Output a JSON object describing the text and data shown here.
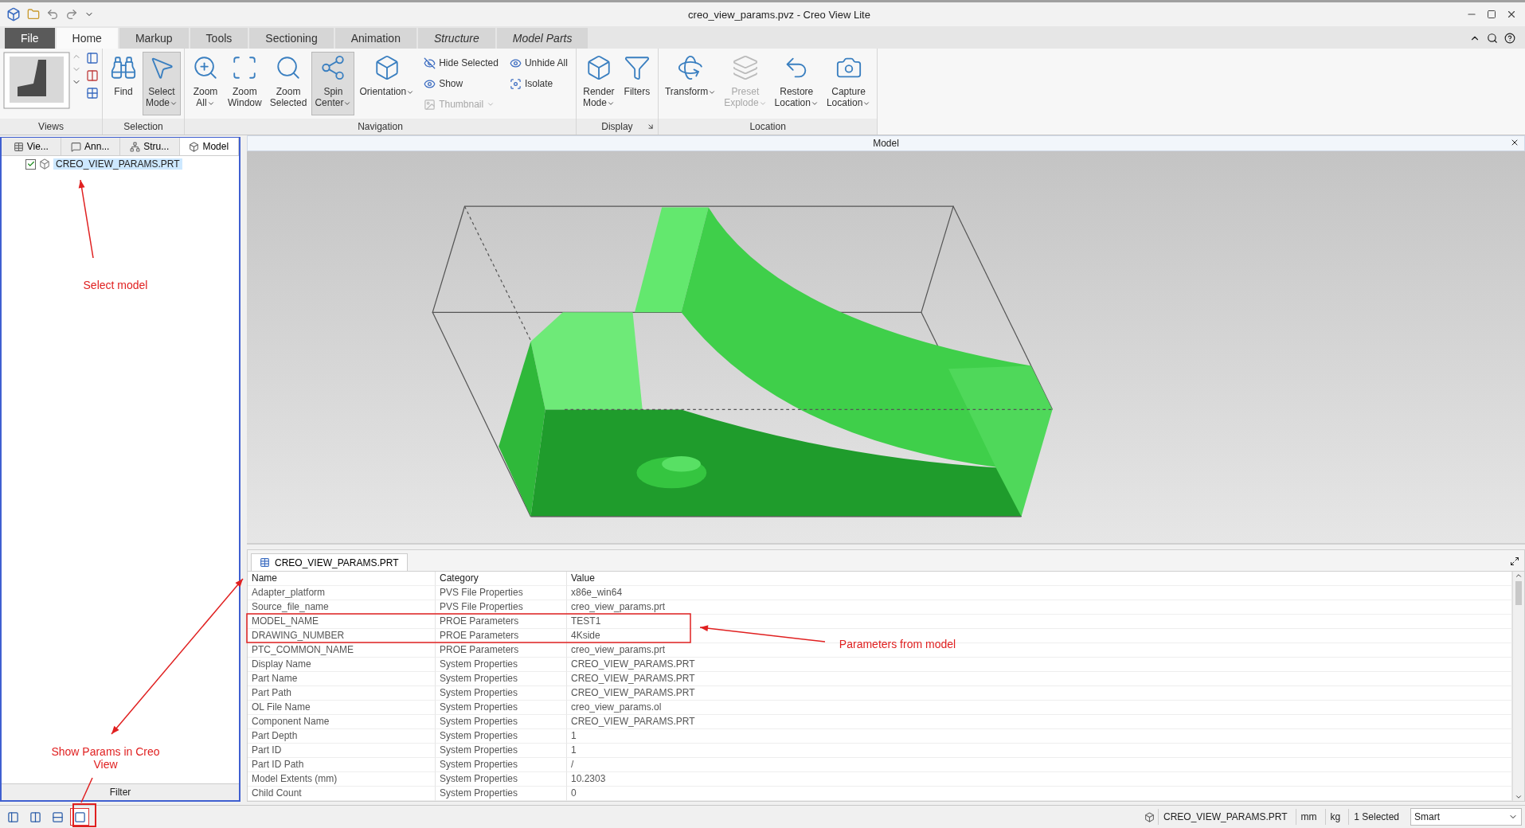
{
  "window": {
    "title": "creo_view_params.pvz - Creo View Lite"
  },
  "ribbon_tabs": [
    {
      "label": "File",
      "kind": "file",
      "selected": false
    },
    {
      "label": "Home",
      "kind": "normal",
      "selected": true
    },
    {
      "label": "Markup",
      "kind": "normal",
      "selected": false
    },
    {
      "label": "Tools",
      "kind": "normal",
      "selected": false
    },
    {
      "label": "Sectioning",
      "kind": "normal",
      "selected": false
    },
    {
      "label": "Animation",
      "kind": "normal",
      "selected": false
    },
    {
      "label": "Structure",
      "kind": "contextual",
      "selected": false
    },
    {
      "label": "Model Parts",
      "kind": "contextual",
      "selected": false
    }
  ],
  "ribbon_groups": [
    {
      "title": "Views",
      "kind": "views"
    },
    {
      "title": "Selection",
      "kind": "buttons",
      "buttons": [
        {
          "lines": [
            "Find"
          ],
          "pressed": false,
          "disabled": false,
          "dropdown": false
        },
        {
          "lines": [
            "Select",
            "Mode"
          ],
          "pressed": true,
          "disabled": false,
          "dropdown": true
        }
      ]
    },
    {
      "title": "Navigation",
      "kind": "buttons",
      "buttons": [
        {
          "lines": [
            "Zoom",
            "All"
          ],
          "pressed": false,
          "disabled": false,
          "dropdown": true
        },
        {
          "lines": [
            "Zoom",
            "Window"
          ],
          "pressed": false,
          "disabled": false,
          "dropdown": false
        },
        {
          "lines": [
            "Zoom",
            "Selected"
          ],
          "pressed": false,
          "disabled": false,
          "dropdown": false
        },
        {
          "lines": [
            "Spin",
            "Center"
          ],
          "pressed": true,
          "disabled": false,
          "dropdown": true
        },
        {
          "lines": [
            "Orientation"
          ],
          "pressed": false,
          "disabled": false,
          "dropdown": true
        }
      ],
      "small_buttons": [
        [
          {
            "label": "Hide Selected",
            "disabled": false,
            "dropdown": false
          },
          {
            "label": "Show",
            "disabled": false,
            "dropdown": false
          },
          {
            "label": "Thumbnail",
            "disabled": true,
            "dropdown": true
          }
        ],
        [
          {
            "label": "Unhide All",
            "disabled": false,
            "dropdown": false
          },
          {
            "label": "Isolate",
            "disabled": false,
            "dropdown": false
          }
        ]
      ]
    },
    {
      "title": "Display",
      "kind": "buttons",
      "launcher": true,
      "buttons": [
        {
          "lines": [
            "Render",
            "Mode"
          ],
          "pressed": false,
          "disabled": false,
          "dropdown": true
        },
        {
          "lines": [
            "Filters"
          ],
          "pressed": false,
          "disabled": false,
          "dropdown": false
        }
      ]
    },
    {
      "title": "Location",
      "kind": "buttons",
      "buttons": [
        {
          "lines": [
            "Transform"
          ],
          "pressed": false,
          "disabled": false,
          "dropdown": true
        },
        {
          "lines": [
            "Preset",
            "Explode"
          ],
          "pressed": false,
          "disabled": true,
          "dropdown": true
        },
        {
          "lines": [
            "Restore",
            "Location"
          ],
          "pressed": false,
          "disabled": false,
          "dropdown": true
        },
        {
          "lines": [
            "Capture",
            "Location"
          ],
          "pressed": false,
          "disabled": false,
          "dropdown": true
        }
      ]
    }
  ],
  "sidebar": {
    "tabs": [
      {
        "label": "Vie...",
        "selected": false
      },
      {
        "label": "Ann...",
        "selected": false
      },
      {
        "label": "Stru...",
        "selected": false
      },
      {
        "label": "Model",
        "selected": true
      }
    ],
    "tree": [
      {
        "label": "CREO_VIEW_PARAMS.PRT",
        "checked": true,
        "selected": true
      }
    ],
    "footer": "Filter"
  },
  "viewport": {
    "title": "Model"
  },
  "properties": {
    "tab": "CREO_VIEW_PARAMS.PRT",
    "columns": [
      "Name",
      "Category",
      "Value"
    ],
    "rows": [
      [
        "Adapter_platform",
        "PVS File Properties",
        "x86e_win64"
      ],
      [
        "Source_file_name",
        "PVS File Properties",
        "creo_view_params.prt"
      ],
      [
        "MODEL_NAME",
        "PROE Parameters",
        "TEST1"
      ],
      [
        "DRAWING_NUMBER",
        "PROE Parameters",
        "4Kside"
      ],
      [
        "PTC_COMMON_NAME",
        "PROE Parameters",
        "creo_view_params.prt"
      ],
      [
        "Display Name",
        "System Properties",
        "CREO_VIEW_PARAMS.PRT"
      ],
      [
        "Part Name",
        "System Properties",
        "CREO_VIEW_PARAMS.PRT"
      ],
      [
        "Part Path",
        "System Properties",
        "CREO_VIEW_PARAMS.PRT"
      ],
      [
        "OL File Name",
        "System Properties",
        "creo_view_params.ol"
      ],
      [
        "Component Name",
        "System Properties",
        "CREO_VIEW_PARAMS.PRT"
      ],
      [
        "Part Depth",
        "System Properties",
        "1"
      ],
      [
        "Part ID",
        "System Properties",
        "1"
      ],
      [
        "Part ID Path",
        "System Properties",
        "/"
      ],
      [
        "Model Extents (mm)",
        "System Properties",
        "10.2303"
      ],
      [
        "Child Count",
        "System Properties",
        "0"
      ]
    ]
  },
  "status_bar": {
    "layouts": [
      {
        "selected": false
      },
      {
        "selected": false
      },
      {
        "selected": false
      },
      {
        "selected": true
      }
    ],
    "part": "CREO_VIEW_PARAMS.PRT",
    "units": [
      "mm",
      "kg"
    ],
    "selection": "1 Selected",
    "mode": "Smart"
  },
  "annotations": [
    {
      "text": "Select model"
    },
    {
      "text": "Show Params in Creo View"
    },
    {
      "text": "Parameters from model"
    }
  ]
}
